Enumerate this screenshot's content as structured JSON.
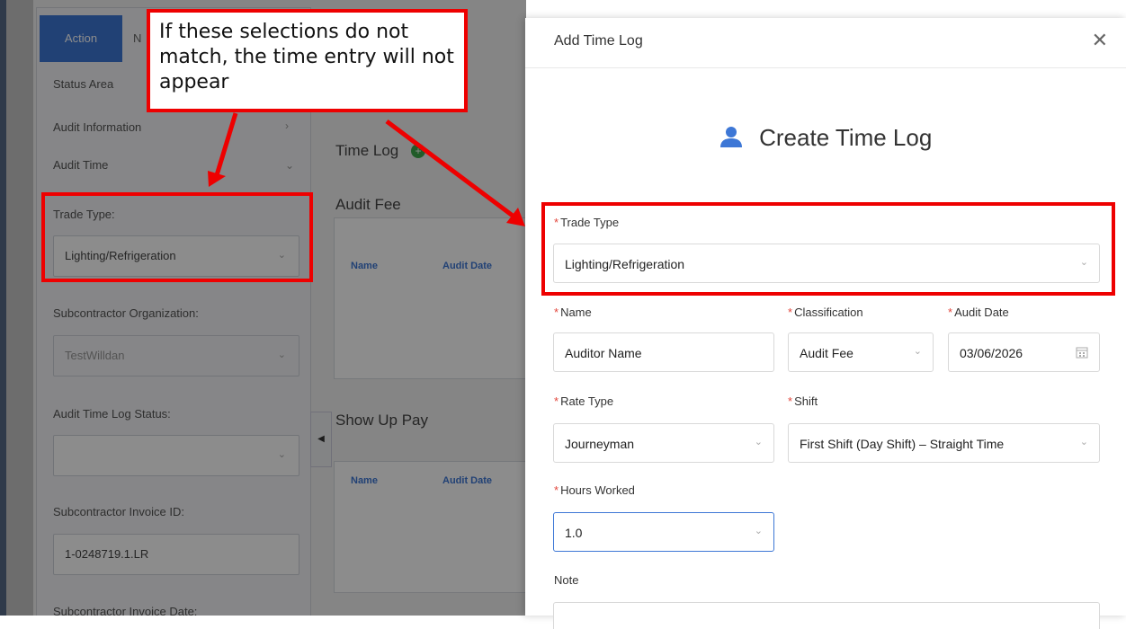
{
  "background_app": {
    "tabs": [
      {
        "label": "Action"
      },
      {
        "label": "N"
      }
    ],
    "sidebar": {
      "items": [
        {
          "label": "Status Area"
        },
        {
          "label": "Audit Information"
        },
        {
          "label": "Audit Time"
        }
      ],
      "trade_type_label": "Trade Type:",
      "trade_type_value": "Lighting/Refrigeration",
      "subcontractor_org_label": "Subcontractor Organization:",
      "subcontractor_org_value": "TestWilldan",
      "time_log_status_label": "Audit Time Log Status:",
      "invoice_id_label": "Subcontractor Invoice ID:",
      "invoice_id_value": "1-0248719.1.LR",
      "invoice_date_label": "Subcontractor Invoice Date:"
    },
    "main": {
      "time_log_label": "Time Log",
      "audit_fee_label": "Audit Fee",
      "show_up_pay_label": "Show Up Pay",
      "col_name": "Name",
      "col_audit_date": "Audit Date"
    }
  },
  "modal": {
    "title": "Add Time Log",
    "close_glyph": "✕",
    "heading": "Create Time Log",
    "trade_type": {
      "label": "Trade Type",
      "value": "Lighting/Refrigeration"
    },
    "name": {
      "label": "Name",
      "value": "Auditor Name"
    },
    "classification": {
      "label": "Classification",
      "value": "Audit Fee"
    },
    "audit_date": {
      "label": "Audit Date",
      "value": "03/06/2026"
    },
    "rate_type": {
      "label": "Rate Type",
      "value": "Journeyman"
    },
    "shift": {
      "label": "Shift",
      "value": "First Shift (Day Shift) – Straight Time"
    },
    "hours_worked": {
      "label": "Hours Worked",
      "value": "1.0"
    },
    "note": {
      "label": "Note"
    }
  },
  "annotation": {
    "callout_text": "If these selections do not match, the time entry will not appear",
    "color": "#e00000"
  },
  "icons": {
    "user": "user-icon",
    "calendar": "calendar-icon",
    "chevron": "chevron-down-icon",
    "add": "add-circle-icon"
  },
  "colors": {
    "primary": "#3d77d6",
    "required": "#e2463c",
    "add_green": "#3da84b"
  }
}
